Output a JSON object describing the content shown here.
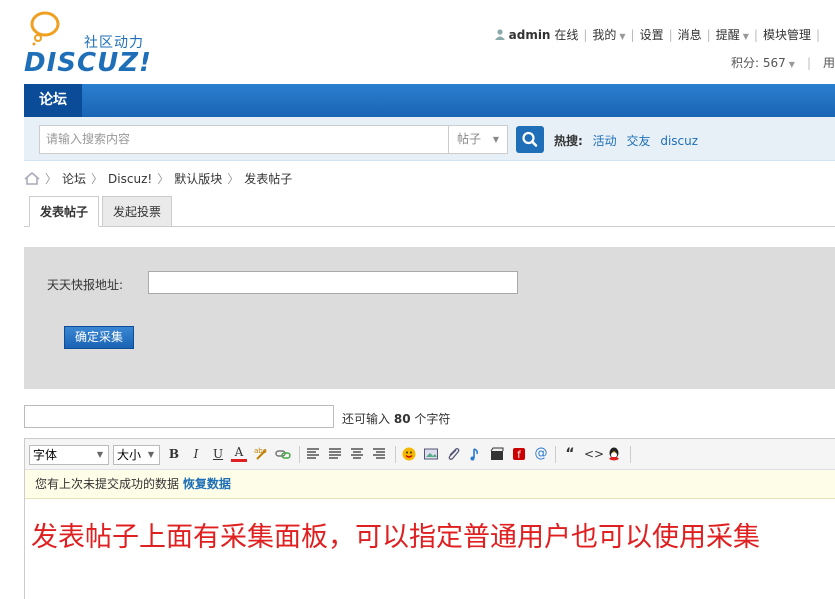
{
  "header": {
    "logo_tagline": "社区动力",
    "logo_text": "DISCUZ!",
    "user": {
      "username": "admin",
      "status": "在线",
      "links": [
        "我的",
        "设置",
        "消息",
        "提醒",
        "模块管理"
      ]
    },
    "points_label": "积分: 567",
    "user_group_partial": "用"
  },
  "nav": {
    "active_tab": "论坛"
  },
  "search": {
    "placeholder": "请输入搜索内容",
    "type": "帖子",
    "hot_label": "热搜:",
    "hot_terms": [
      "活动",
      "交友",
      "discuz"
    ]
  },
  "breadcrumb": [
    "论坛",
    "Discuz!",
    "默认版块",
    "发表帖子"
  ],
  "tabs": [
    "发表帖子",
    "发起投票"
  ],
  "collect_panel": {
    "label": "天天快报地址:",
    "url_value": "",
    "button": "确定采集"
  },
  "subject": {
    "value": "",
    "hint_prefix": "还可输入",
    "hint_count": "80",
    "hint_suffix": "个字符"
  },
  "editor": {
    "font_select": "字体",
    "size_select": "大小",
    "notice_text": "您有上次未提交成功的数据",
    "notice_link": "恢复数据",
    "content": "发表帖子上面有采集面板，可以指定普通用户也可以使用采集"
  },
  "colors": {
    "brand_blue": "#1e6fb8",
    "nav_active": "#0a4c98",
    "content_red": "#e02020",
    "panel_gray": "#dcdcdc"
  }
}
